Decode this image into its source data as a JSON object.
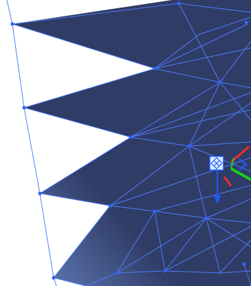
{
  "viewport": {
    "background_color": "#ffffff",
    "mesh": {
      "fill_dark": "#2f3c66",
      "fill_light": "#6a86c4",
      "wire_color": "#4f7dff",
      "vertex_color": "#2f64ff"
    },
    "gizmo": {
      "icon": "move-rotate-gizmo-icon",
      "handle_color": "#d8ecff",
      "x_axis_color": "#ff2a2a",
      "y_axis_color": "#19d11f",
      "z_axis_color": "#1e55ff"
    }
  }
}
